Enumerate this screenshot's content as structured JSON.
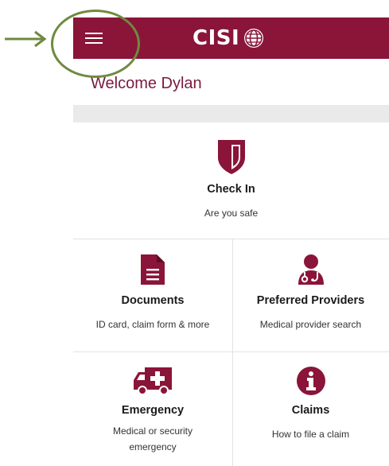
{
  "header": {
    "logo_text": "CISI",
    "brand_color": "#8a1538",
    "menu_icon": "hamburger-icon",
    "logo_icon": "globe-icon"
  },
  "welcome_text": "Welcome Dylan",
  "tiles": [
    {
      "title": "Check In",
      "subtitle": "Are you safe",
      "icon": "shield-icon"
    },
    {
      "title": "Documents",
      "subtitle": "ID card, claim form & more",
      "icon": "document-icon"
    },
    {
      "title": "Preferred Providers",
      "subtitle": "Medical provider search",
      "icon": "doctor-icon"
    },
    {
      "title": "Emergency",
      "subtitle": "Medical or security emergency",
      "icon": "ambulance-icon"
    },
    {
      "title": "Claims",
      "subtitle": "How to file a claim",
      "icon": "info-icon"
    }
  ],
  "accent_color": "#8a1538",
  "annotation": {
    "arrow_color": "#6f8a3e",
    "circle_color": "#6f8a3e"
  }
}
